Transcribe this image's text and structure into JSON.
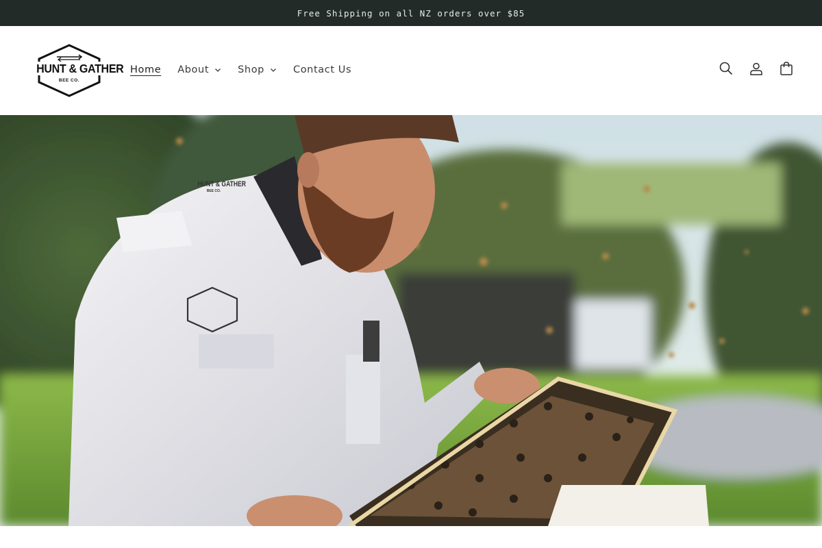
{
  "announcement": {
    "text": "Free Shipping on all NZ orders over $85"
  },
  "header": {
    "logo": {
      "line1": "HUNT & GATHER",
      "line2": "BEE CO."
    },
    "nav": [
      {
        "label": "Home",
        "active": true,
        "has_dropdown": false
      },
      {
        "label": "About",
        "active": false,
        "has_dropdown": true
      },
      {
        "label": "Shop",
        "active": false,
        "has_dropdown": true
      },
      {
        "label": "Contact Us",
        "active": false,
        "has_dropdown": false
      }
    ],
    "icons": [
      "search-icon",
      "account-icon",
      "cart-icon"
    ]
  },
  "hero": {
    "image": "beekeeper-inspecting-hive-frame",
    "suit_logo": {
      "line1": "HUNT & GATHER",
      "line2": "BEE CO."
    }
  },
  "colors": {
    "announcement_bg": "#232b28",
    "text": "#2b2b2b",
    "accent": "#1f1f1f"
  }
}
